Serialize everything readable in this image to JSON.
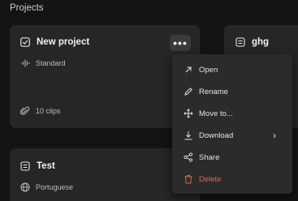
{
  "section": {
    "title": "Projects"
  },
  "cards": {
    "new_project": {
      "title": "New project",
      "mode": "Standard",
      "clips": "10 clips",
      "more_label": "•••"
    },
    "ghg": {
      "title": "ghg"
    },
    "test": {
      "title": "Test",
      "language": "Portuguese"
    }
  },
  "menu": {
    "open": "Open",
    "rename": "Rename",
    "move": "Move to...",
    "download": "Download",
    "download_arrow": "›",
    "share": "Share",
    "delete": "Delete"
  },
  "colors": {
    "background": "#141414",
    "card": "#262626",
    "menu": "#2b2b2b",
    "danger": "#e0654f"
  },
  "icons": {
    "project": "checkbox-icon",
    "document": "document-icon",
    "waveform": "waveform-icon",
    "paperclip": "paperclip-icon",
    "globe": "globe-icon"
  }
}
